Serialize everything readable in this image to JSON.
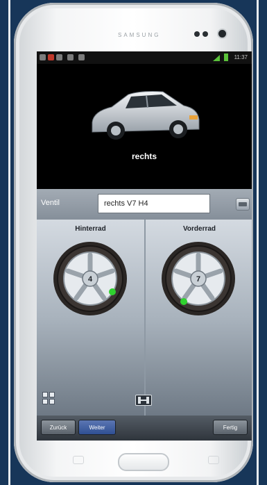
{
  "device": {
    "brand": "SAMSUNG"
  },
  "status_bar": {
    "time": "11:37"
  },
  "hero": {
    "car_label": "rechts"
  },
  "valve": {
    "label": "Ventil",
    "value": "rechts V7 H4"
  },
  "wheels": {
    "rear": {
      "title": "Hinterrad",
      "number": "4"
    },
    "front": {
      "title": "Vorderrad",
      "number": "7"
    }
  },
  "buttons": {
    "back": "Zurück",
    "next": "Weiter",
    "done": "Fertig"
  },
  "colors": {
    "valve_dot": "#2fd22f",
    "next_button": "#2f4f93"
  }
}
